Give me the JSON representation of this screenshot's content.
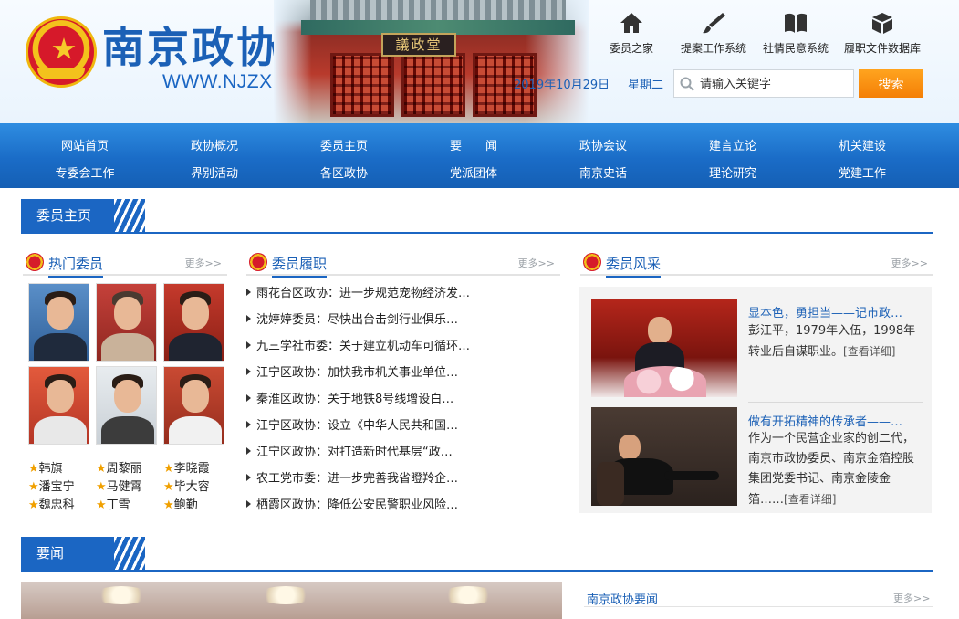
{
  "header": {
    "site_title": "南京政协",
    "site_url": "WWW.NJZX.GOV.CN",
    "banner_plaque": "議政堂",
    "date": "2019年10月29日",
    "weekday": "星期二",
    "quick_links": [
      {
        "label": "委员之家",
        "icon": "home-icon"
      },
      {
        "label": "提案工作系统",
        "icon": "brush-icon"
      },
      {
        "label": "社情民意系统",
        "icon": "book-icon"
      },
      {
        "label": "履职文件数据库",
        "icon": "box-icon"
      }
    ],
    "search_placeholder": "请输入关键字",
    "search_button": "搜索",
    "accent_color": "#1b66c3",
    "search_button_color": "#f68b0e"
  },
  "nav": {
    "row1": [
      "网站首页",
      "政协概况",
      "委员主页",
      "要　　闻",
      "政协会议",
      "建言立论",
      "机关建设"
    ],
    "row2": [
      "专委会工作",
      "界别活动",
      "各区政协",
      "党派团体",
      "南京史话",
      "理论研究",
      "党建工作"
    ]
  },
  "section_member": {
    "title": "委员主页",
    "hot_members": {
      "title": "热门委员",
      "more": "更多>>",
      "names": [
        "韩旗",
        "周黎丽",
        "李晓霞",
        "潘宝宁",
        "马健霄",
        "毕大容",
        "魏忠科",
        "丁雪",
        "鲍勤"
      ]
    },
    "duties": {
      "title": "委员履职",
      "more": "更多>>",
      "items": [
        "雨花台区政协：进一步规范宠物经济发…",
        "沈婷婷委员：尽快出台击剑行业俱乐…",
        "九三学社市委：关于建立机动车可循环…",
        "江宁区政协：加快我市机关事业单位…",
        "秦淮区政协：关于地铁8号线增设白…",
        "江宁区政协：设立《中华人民共和国…",
        "江宁区政协：对打造新时代基层“政…",
        "农工党市委：进一步完善我省瞪羚企…",
        "栖霞区政协：降低公安民警职业风险…"
      ]
    },
    "style": {
      "title": "委员风采",
      "more": "更多>>",
      "features": [
        {
          "title": "显本色，勇担当——记市政…",
          "desc": "彭江平，1979年入伍，1998年转业后自谋职业。",
          "detail": "[查看详细]"
        },
        {
          "title": "做有开拓精神的传承者——…",
          "desc": "作为一个民营企业家的创二代，南京市政协委员、南京金箔控股集团党委书记、南京金陵金箔……",
          "detail": "[查看详细]"
        }
      ]
    }
  },
  "section_news": {
    "title": "要闻",
    "sub_title": "南京政协要闻",
    "more": "更多>>"
  }
}
